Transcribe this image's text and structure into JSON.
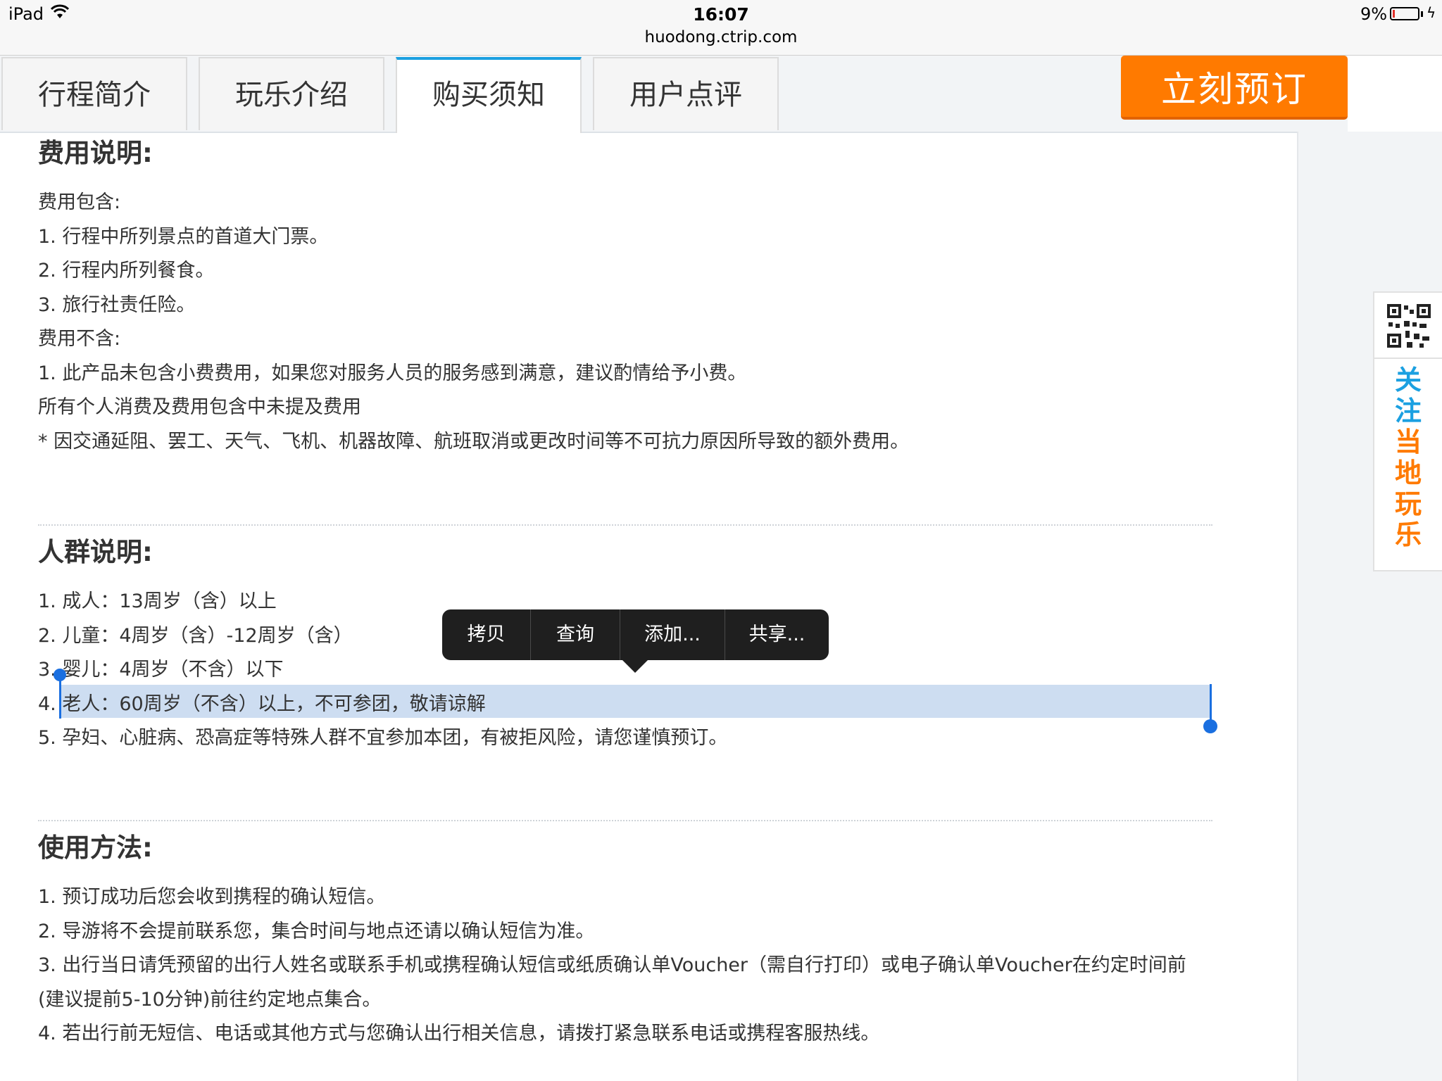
{
  "status_bar": {
    "device": "iPad",
    "time": "16:07",
    "url": "huodong.ctrip.com",
    "battery_percent": "9%",
    "battery_level": 0.09
  },
  "tabs": [
    {
      "label": "行程简介",
      "active": false
    },
    {
      "label": "玩乐介绍",
      "active": false
    },
    {
      "label": "购买须知",
      "active": true
    },
    {
      "label": "用户点评",
      "active": false
    }
  ],
  "book_button": "立刻预订",
  "follow_widget": {
    "chars": [
      "关",
      "注",
      "当",
      "地",
      "玩",
      "乐"
    ]
  },
  "sections": {
    "fees": {
      "title": "费用说明:",
      "lines": [
        "费用包含:",
        "1. 行程中所列景点的首道大门票。",
        "2. 行程内所列餐食。",
        "3. 旅行社责任险。",
        "费用不含:",
        "1. 此产品未包含小费费用，如果您对服务人员的服务感到满意，建议酌情给予小费。",
        "所有个人消费及费用包含中未提及费用",
        "* 因交通延阻、罢工、天气、飞机、机器故障、航班取消或更改时间等不可抗力原因所导致的额外费用。"
      ]
    },
    "crowd": {
      "title": "人群说明:",
      "lines": [
        "1. 成人：13周岁（含）以上",
        "2. 儿童：4周岁（含）-12周岁（含）",
        "3. 婴儿：4周岁（不含）以下",
        "4. 老人：60周岁（不含）以上，不可参团，敬请谅解",
        "5. 孕妇、心脏病、恐高症等特殊人群不宜参加本团，有被拒风险，请您谨慎预订。"
      ]
    },
    "usage": {
      "title": "使用方法:",
      "lines": [
        "1. 预订成功后您会收到携程的确认短信。",
        "2. 导游将不会提前联系您，集合时间与地点还请以确认短信为准。",
        "3. 出行当日请凭预留的出行人姓名或联系手机或携程确认短信或纸质确认单Voucher（需自行打印）或电子确认单Voucher在约定时间前(建议提前5-10分钟)前往约定地点集合。",
        "4. 若出行前无短信、电话或其他方式与您确认出行相关信息，请拨打紧急联系电话或携程客服热线。"
      ]
    }
  },
  "context_menu": [
    "拷贝",
    "查询",
    "添加...",
    "共享..."
  ],
  "colors": {
    "accent_orange": "#ff7a00",
    "tab_active": "#1ba0e1",
    "selection": "#1a6fe0"
  }
}
